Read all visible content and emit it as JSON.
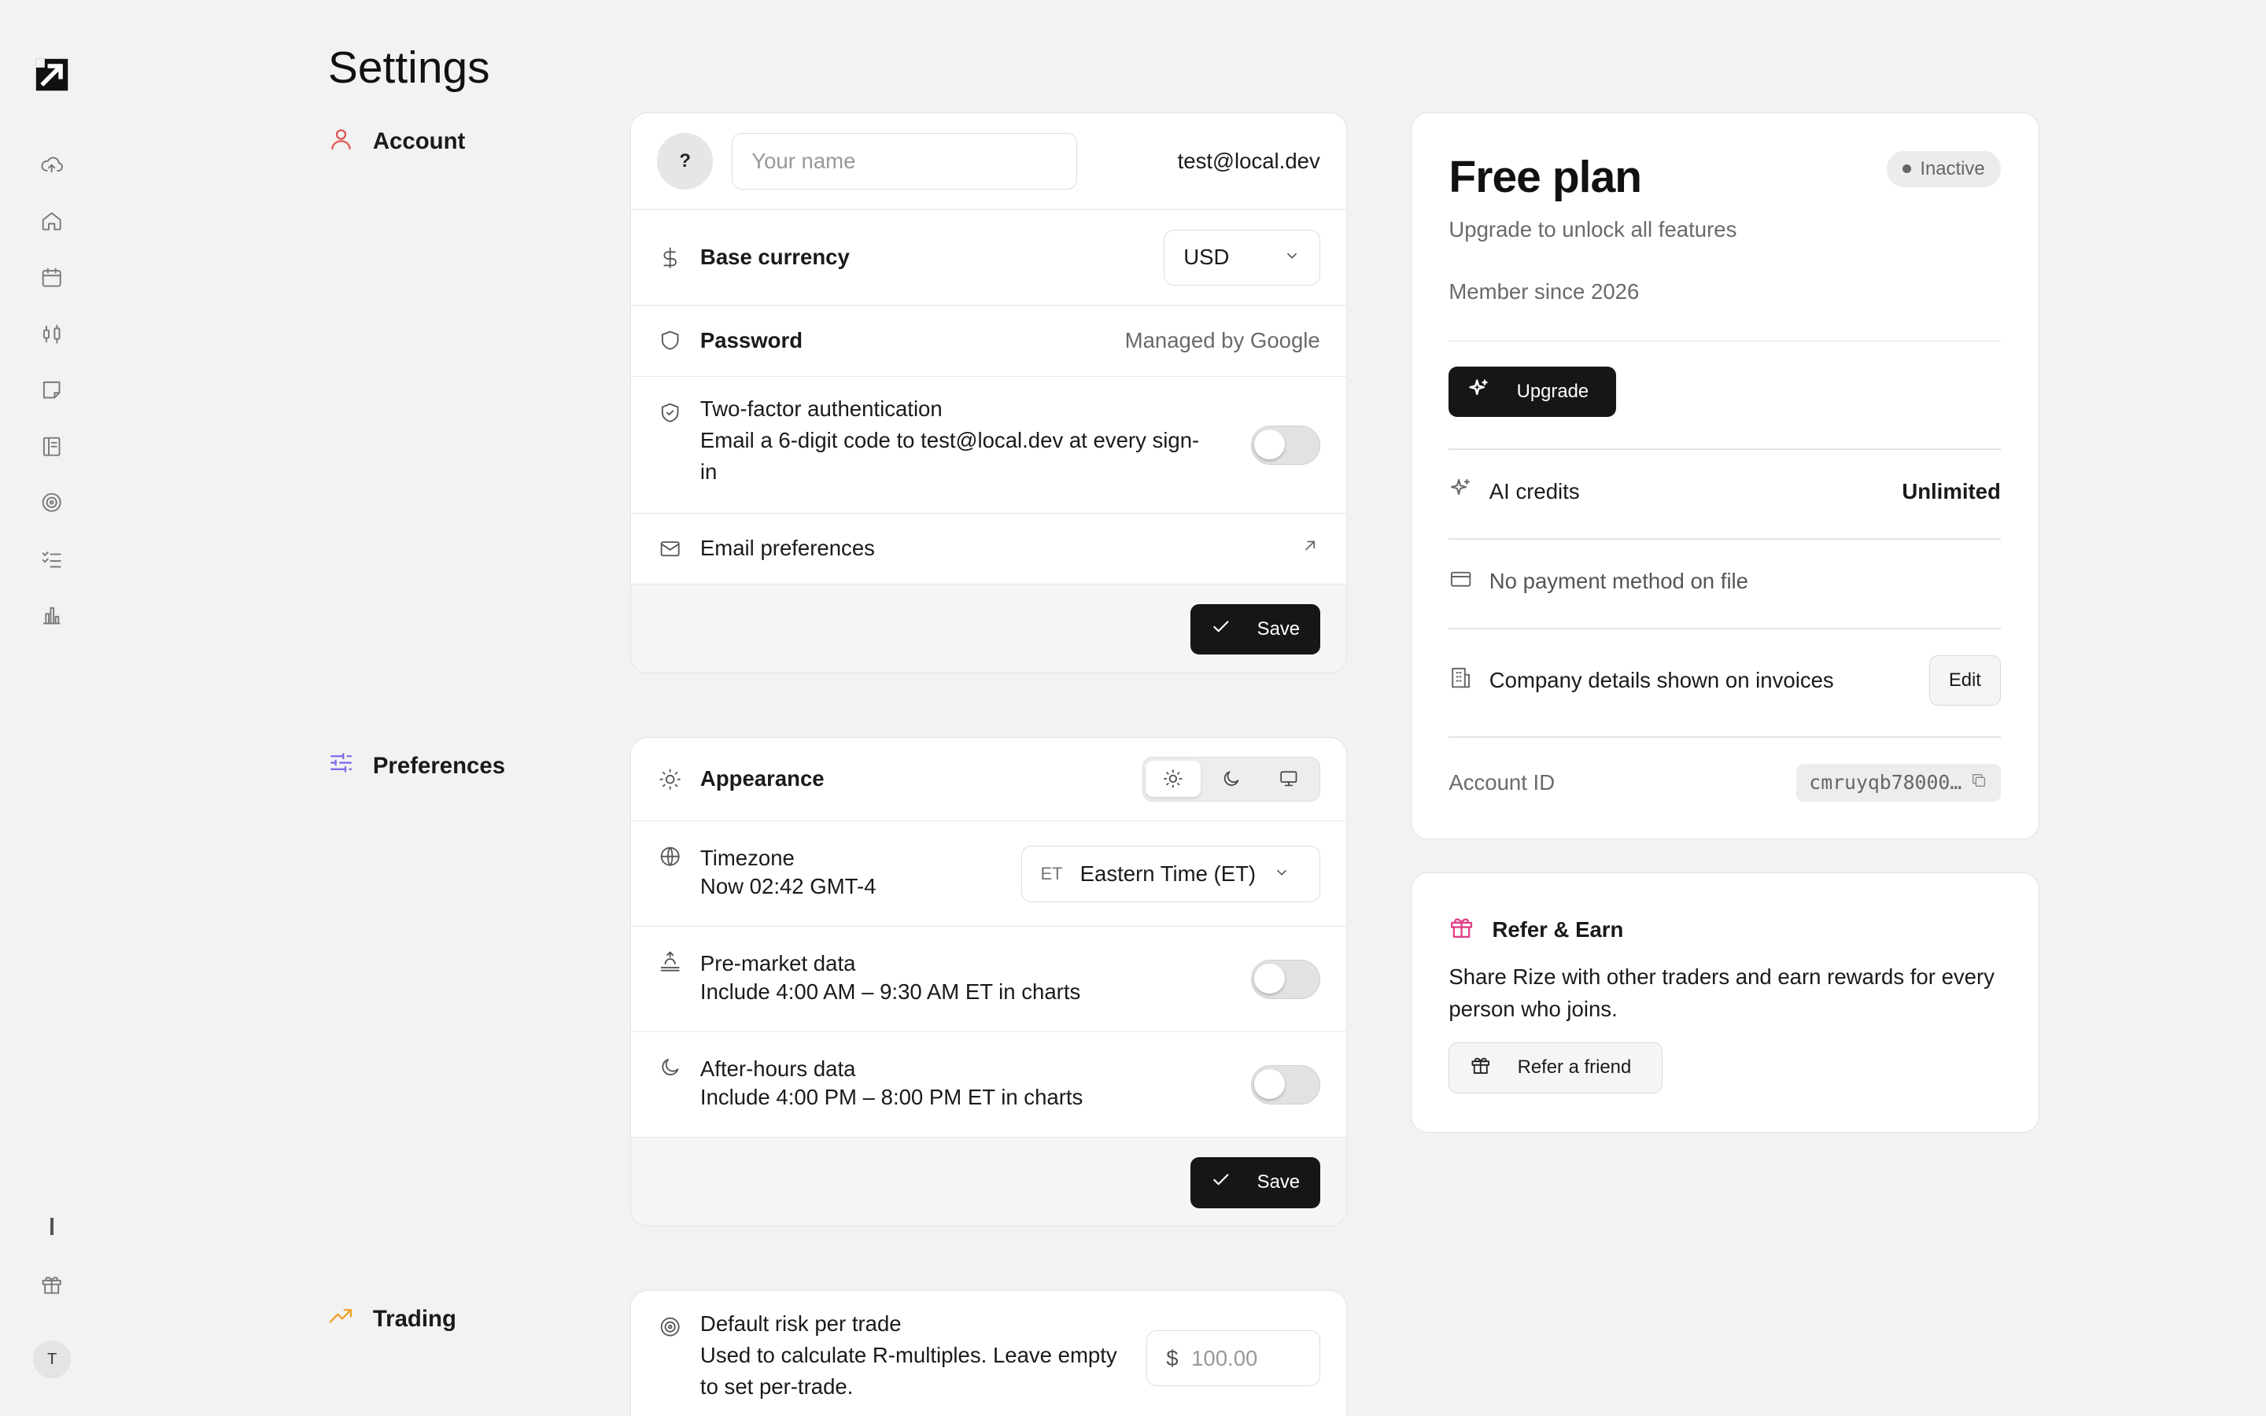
{
  "page": {
    "title": "Settings"
  },
  "sidebar": {
    "icons": [
      "logo-icon",
      "cloud-upload-icon",
      "home-icon",
      "calendar-icon",
      "candlestick-icon",
      "note-icon",
      "book-icon",
      "target-icon",
      "checklist-icon",
      "bar-chart-icon"
    ],
    "avatar": "T"
  },
  "sections": {
    "account": "Account",
    "preferences": "Preferences",
    "trading": "Trading"
  },
  "account": {
    "avatar": "?",
    "name_placeholder": "Your name",
    "email": "test@local.dev",
    "base_currency_label": "Base currency",
    "base_currency_value": "USD",
    "password_label": "Password",
    "password_value": "Managed by Google",
    "twofa_label": "Two-factor authentication",
    "twofa_desc": "Email a 6-digit code to test@local.dev at every sign-in",
    "email_prefs_label": "Email preferences",
    "save": "Save"
  },
  "preferences": {
    "appearance_label": "Appearance",
    "timezone_label": "Timezone",
    "timezone_now": "Now 02:42 GMT-4",
    "timezone_abbr": "ET",
    "timezone_value": "Eastern Time (ET)",
    "premarket_label": "Pre-market data",
    "premarket_desc": "Include 4:00 AM – 9:30 AM ET in charts",
    "afterhours_label": "After-hours data",
    "afterhours_desc": "Include 4:00 PM – 8:00 PM ET in charts",
    "save": "Save"
  },
  "trading": {
    "risk_label": "Default risk per trade",
    "risk_desc": "Used to calculate R-multiples. Leave empty to set per-trade.",
    "risk_prefix": "$",
    "risk_placeholder": "100.00"
  },
  "plan": {
    "title": "Free plan",
    "status": "Inactive",
    "subtitle": "Upgrade to unlock all features",
    "member_since": "Member since 2026",
    "upgrade": "Upgrade",
    "ai_credits_label": "AI credits",
    "ai_credits_value": "Unlimited",
    "payment": "No payment method on file",
    "company_label": "Company details shown on invoices",
    "edit": "Edit",
    "account_id_label": "Account ID",
    "account_id_value": "cmruyqb78000…"
  },
  "refer": {
    "title": "Refer & Earn",
    "desc": "Share Rize with other traders and earn rewards for every person who joins.",
    "button": "Refer a friend"
  },
  "colors": {
    "account_icon": "#e05a5a",
    "preferences_icon": "#7b6cf0",
    "trading_icon": "#f0a028",
    "refer_icon": "#e0408a"
  }
}
